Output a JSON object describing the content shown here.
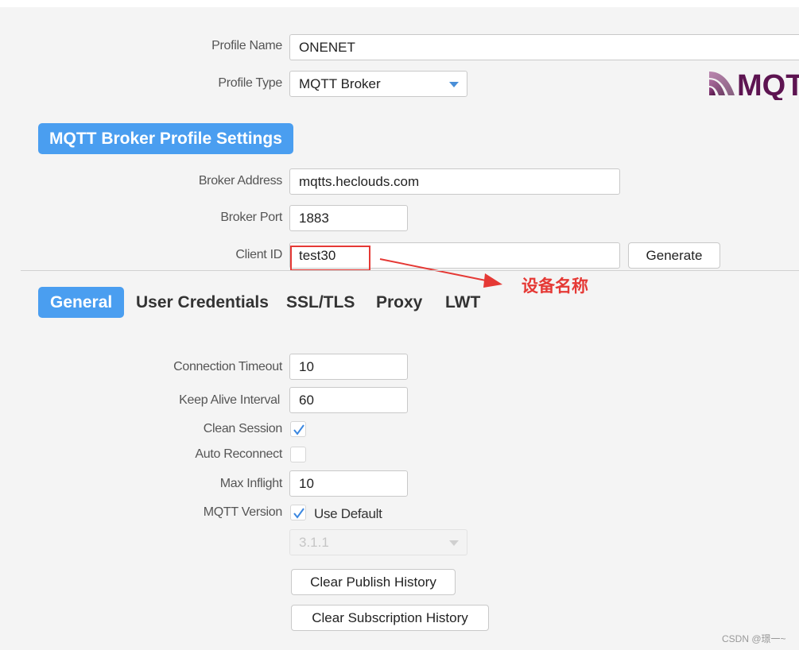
{
  "profile": {
    "name_label": "Profile Name",
    "name_value": "ONENET",
    "type_label": "Profile Type",
    "type_value": "MQTT Broker",
    "logo_text": "MQT"
  },
  "broker_section": {
    "title": "MQTT Broker Profile Settings",
    "address_label": "Broker Address",
    "address_value": "mqtts.heclouds.com",
    "port_label": "Broker Port",
    "port_value": "1883",
    "client_id_label": "Client ID",
    "client_id_value": "test30",
    "generate_label": "Generate"
  },
  "annotation": {
    "text": "设备名称",
    "color": "#e53935"
  },
  "tabs": [
    {
      "label": "General",
      "active": true
    },
    {
      "label": "User Credentials",
      "active": false
    },
    {
      "label": "SSL/TLS",
      "active": false
    },
    {
      "label": "Proxy",
      "active": false
    },
    {
      "label": "LWT",
      "active": false
    }
  ],
  "general": {
    "connection_timeout_label": "Connection Timeout",
    "connection_timeout_value": "10",
    "keep_alive_label": "Keep Alive Interval",
    "keep_alive_value": "60",
    "clean_session_label": "Clean Session",
    "clean_session_checked": true,
    "auto_reconnect_label": "Auto Reconnect",
    "auto_reconnect_checked": false,
    "max_inflight_label": "Max Inflight",
    "max_inflight_value": "10",
    "mqtt_version_label": "MQTT Version",
    "use_default_label": "Use Default",
    "use_default_checked": true,
    "version_value": "3.1.1",
    "clear_publish_label": "Clear Publish History",
    "clear_subscription_label": "Clear Subscription History"
  },
  "watermark": "CSDN @璟一~",
  "colors": {
    "accent": "#4a9ef0",
    "annotation_red": "#e53935",
    "logo_purple": "#6a1b5a"
  }
}
